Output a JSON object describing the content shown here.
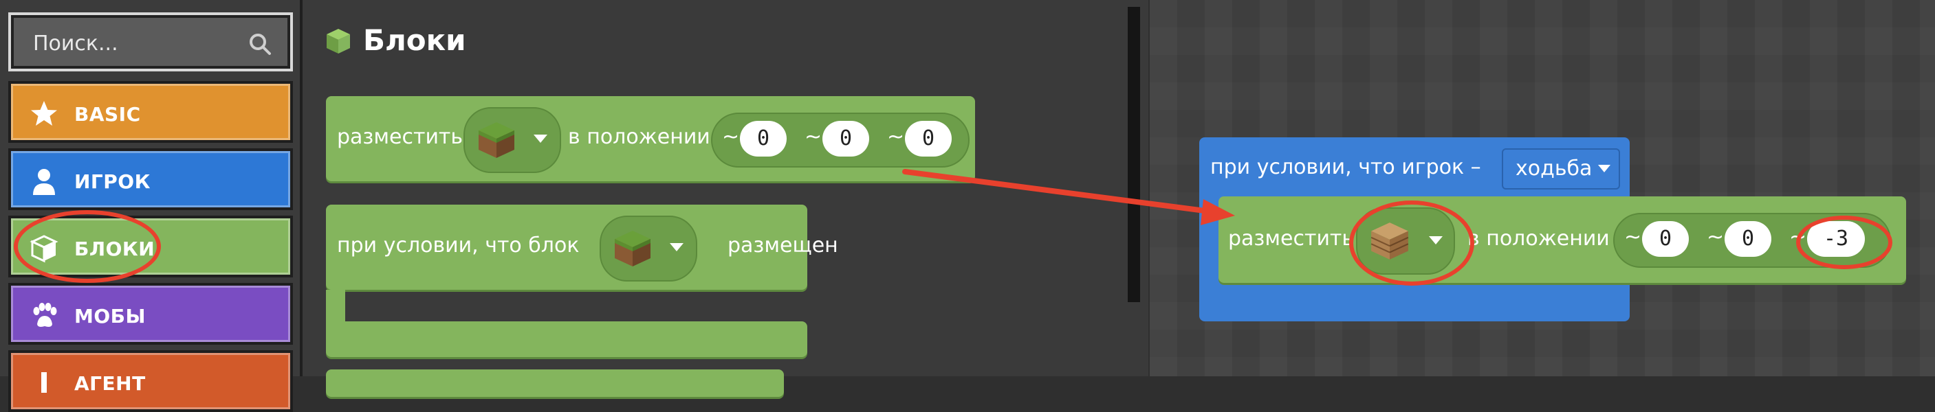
{
  "sidebar": {
    "search_placeholder": "Поиск...",
    "categories": [
      {
        "label": "BASIC",
        "color": "#e0922f",
        "icon": "star-icon"
      },
      {
        "label": "ИГРОК",
        "color": "#2d78d6",
        "icon": "person-icon"
      },
      {
        "label": "БЛОКИ",
        "color": "#84b55d",
        "icon": "cube-icon"
      },
      {
        "label": "МОБЫ",
        "color": "#7a4dc2",
        "icon": "paw-icon"
      },
      {
        "label": "АГЕНТ",
        "color": "#d25a2a",
        "icon": "agent-icon"
      }
    ]
  },
  "palette": {
    "title": "Блоки",
    "block1": {
      "word1": "разместить",
      "word2": "в положении",
      "x": "0",
      "y": "0",
      "z": "0"
    },
    "block2": {
      "word1": "при условии, что блок",
      "word2": "размещен"
    }
  },
  "workspace": {
    "event_text": "при условии, что игрок –",
    "event_dropdown": "ходьба",
    "place_word1": "разместить",
    "place_word2": "в положении",
    "x": "0",
    "y": "0",
    "z": "-3"
  },
  "tilde": "~",
  "colors": {
    "green": "#84b55d",
    "blue": "#3b7fd6",
    "highlight": "#e8412d"
  }
}
